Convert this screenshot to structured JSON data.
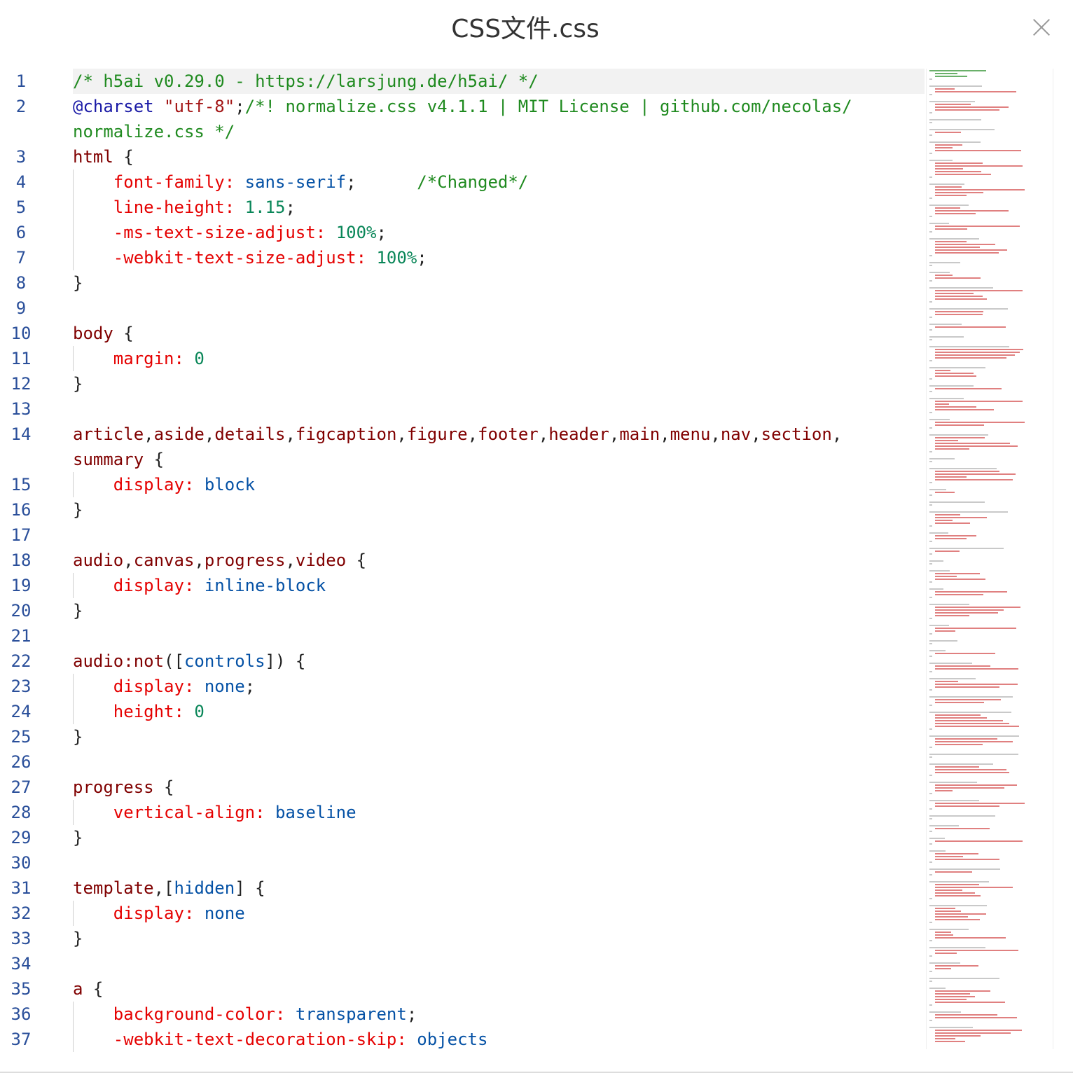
{
  "title": "CSS文件.css",
  "close_icon": "close-x-icon",
  "colors": {
    "comment": "#1f8a1f",
    "selector": "#800000",
    "property": "#e50000",
    "value": "#0451a5",
    "number": "#098658",
    "line_number": "#2a4f9a"
  },
  "lines": [
    {
      "n": "1",
      "cur": true,
      "tokens": [
        {
          "t": "/* h5ai v0.29.0 - https://larsjung.de/h5ai/ */",
          "c": "comment"
        }
      ]
    },
    {
      "n": "2",
      "tokens": [
        {
          "t": "@charset",
          "c": "at"
        },
        {
          "t": " \"utf-8\"",
          "c": "str"
        },
        {
          "t": ";",
          "c": "punc"
        },
        {
          "t": "/*! normalize.css v4.1.1 | MIT License | github.com/necolas/",
          "c": "comment"
        }
      ]
    },
    {
      "n": "",
      "tokens": [
        {
          "t": "normalize.css */",
          "c": "comment"
        }
      ]
    },
    {
      "n": "3",
      "tokens": [
        {
          "t": "html",
          "c": "sel"
        },
        {
          "t": " {",
          "c": "punc"
        }
      ]
    },
    {
      "n": "4",
      "guide": true,
      "tokens": [
        {
          "t": "    font-family: ",
          "c": "prop"
        },
        {
          "t": "sans-serif",
          "c": "val"
        },
        {
          "t": ";      ",
          "c": "punc"
        },
        {
          "t": "/*Changed*/",
          "c": "comment"
        }
      ]
    },
    {
      "n": "5",
      "guide": true,
      "tokens": [
        {
          "t": "    line-height: ",
          "c": "prop"
        },
        {
          "t": "1.15",
          "c": "num"
        },
        {
          "t": ";",
          "c": "punc"
        }
      ]
    },
    {
      "n": "6",
      "guide": true,
      "tokens": [
        {
          "t": "    -ms-text-size-adjust: ",
          "c": "prop"
        },
        {
          "t": "100%",
          "c": "num"
        },
        {
          "t": ";",
          "c": "punc"
        }
      ]
    },
    {
      "n": "7",
      "guide": true,
      "tokens": [
        {
          "t": "    -webkit-text-size-adjust: ",
          "c": "prop"
        },
        {
          "t": "100%",
          "c": "num"
        },
        {
          "t": ";",
          "c": "punc"
        }
      ]
    },
    {
      "n": "8",
      "tokens": [
        {
          "t": "}",
          "c": "punc"
        }
      ]
    },
    {
      "n": "9",
      "tokens": []
    },
    {
      "n": "10",
      "tokens": [
        {
          "t": "body",
          "c": "sel"
        },
        {
          "t": " {",
          "c": "punc"
        }
      ]
    },
    {
      "n": "11",
      "guide": true,
      "tokens": [
        {
          "t": "    margin: ",
          "c": "prop"
        },
        {
          "t": "0",
          "c": "num"
        }
      ]
    },
    {
      "n": "12",
      "tokens": [
        {
          "t": "}",
          "c": "punc"
        }
      ]
    },
    {
      "n": "13",
      "tokens": []
    },
    {
      "n": "14",
      "tokens": [
        {
          "t": "article",
          "c": "sel"
        },
        {
          "t": ",",
          "c": "punc"
        },
        {
          "t": "aside",
          "c": "sel"
        },
        {
          "t": ",",
          "c": "punc"
        },
        {
          "t": "details",
          "c": "sel"
        },
        {
          "t": ",",
          "c": "punc"
        },
        {
          "t": "figcaption",
          "c": "sel"
        },
        {
          "t": ",",
          "c": "punc"
        },
        {
          "t": "figure",
          "c": "sel"
        },
        {
          "t": ",",
          "c": "punc"
        },
        {
          "t": "footer",
          "c": "sel"
        },
        {
          "t": ",",
          "c": "punc"
        },
        {
          "t": "header",
          "c": "sel"
        },
        {
          "t": ",",
          "c": "punc"
        },
        {
          "t": "main",
          "c": "sel"
        },
        {
          "t": ",",
          "c": "punc"
        },
        {
          "t": "menu",
          "c": "sel"
        },
        {
          "t": ",",
          "c": "punc"
        },
        {
          "t": "nav",
          "c": "sel"
        },
        {
          "t": ",",
          "c": "punc"
        },
        {
          "t": "section",
          "c": "sel"
        },
        {
          "t": ",",
          "c": "punc"
        }
      ]
    },
    {
      "n": "",
      "tokens": [
        {
          "t": "summary",
          "c": "sel"
        },
        {
          "t": " {",
          "c": "punc"
        }
      ]
    },
    {
      "n": "15",
      "guide": true,
      "tokens": [
        {
          "t": "    display: ",
          "c": "prop"
        },
        {
          "t": "block",
          "c": "val"
        }
      ]
    },
    {
      "n": "16",
      "tokens": [
        {
          "t": "}",
          "c": "punc"
        }
      ]
    },
    {
      "n": "17",
      "tokens": []
    },
    {
      "n": "18",
      "tokens": [
        {
          "t": "audio",
          "c": "sel"
        },
        {
          "t": ",",
          "c": "punc"
        },
        {
          "t": "canvas",
          "c": "sel"
        },
        {
          "t": ",",
          "c": "punc"
        },
        {
          "t": "progress",
          "c": "sel"
        },
        {
          "t": ",",
          "c": "punc"
        },
        {
          "t": "video",
          "c": "sel"
        },
        {
          "t": " {",
          "c": "punc"
        }
      ]
    },
    {
      "n": "19",
      "guide": true,
      "tokens": [
        {
          "t": "    display: ",
          "c": "prop"
        },
        {
          "t": "inline-block",
          "c": "val"
        }
      ]
    },
    {
      "n": "20",
      "tokens": [
        {
          "t": "}",
          "c": "punc"
        }
      ]
    },
    {
      "n": "21",
      "tokens": []
    },
    {
      "n": "22",
      "tokens": [
        {
          "t": "audio",
          "c": "sel"
        },
        {
          "t": ":not",
          "c": "sel"
        },
        {
          "t": "([",
          "c": "punc"
        },
        {
          "t": "controls",
          "c": "val"
        },
        {
          "t": "]) {",
          "c": "punc"
        }
      ]
    },
    {
      "n": "23",
      "guide": true,
      "tokens": [
        {
          "t": "    display: ",
          "c": "prop"
        },
        {
          "t": "none",
          "c": "val"
        },
        {
          "t": ";",
          "c": "punc"
        }
      ]
    },
    {
      "n": "24",
      "guide": true,
      "tokens": [
        {
          "t": "    height: ",
          "c": "prop"
        },
        {
          "t": "0",
          "c": "num"
        }
      ]
    },
    {
      "n": "25",
      "tokens": [
        {
          "t": "}",
          "c": "punc"
        }
      ]
    },
    {
      "n": "26",
      "tokens": []
    },
    {
      "n": "27",
      "tokens": [
        {
          "t": "progress",
          "c": "sel"
        },
        {
          "t": " {",
          "c": "punc"
        }
      ]
    },
    {
      "n": "28",
      "guide": true,
      "tokens": [
        {
          "t": "    vertical-align: ",
          "c": "prop"
        },
        {
          "t": "baseline",
          "c": "val"
        }
      ]
    },
    {
      "n": "29",
      "tokens": [
        {
          "t": "}",
          "c": "punc"
        }
      ]
    },
    {
      "n": "30",
      "tokens": []
    },
    {
      "n": "31",
      "tokens": [
        {
          "t": "template",
          "c": "sel"
        },
        {
          "t": ",[",
          "c": "punc"
        },
        {
          "t": "hidden",
          "c": "val"
        },
        {
          "t": "] {",
          "c": "punc"
        }
      ]
    },
    {
      "n": "32",
      "guide": true,
      "tokens": [
        {
          "t": "    display: ",
          "c": "prop"
        },
        {
          "t": "none",
          "c": "val"
        }
      ]
    },
    {
      "n": "33",
      "tokens": [
        {
          "t": "}",
          "c": "punc"
        }
      ]
    },
    {
      "n": "34",
      "tokens": []
    },
    {
      "n": "35",
      "tokens": [
        {
          "t": "a",
          "c": "sel"
        },
        {
          "t": " {",
          "c": "punc"
        }
      ]
    },
    {
      "n": "36",
      "guide": true,
      "tokens": [
        {
          "t": "    background-color: ",
          "c": "prop"
        },
        {
          "t": "transparent",
          "c": "val"
        },
        {
          "t": ";",
          "c": "punc"
        }
      ]
    },
    {
      "n": "37",
      "guide": true,
      "tokens": [
        {
          "t": "    -webkit-text-decoration-skip: ",
          "c": "prop"
        },
        {
          "t": "objects",
          "c": "val"
        }
      ]
    }
  ]
}
